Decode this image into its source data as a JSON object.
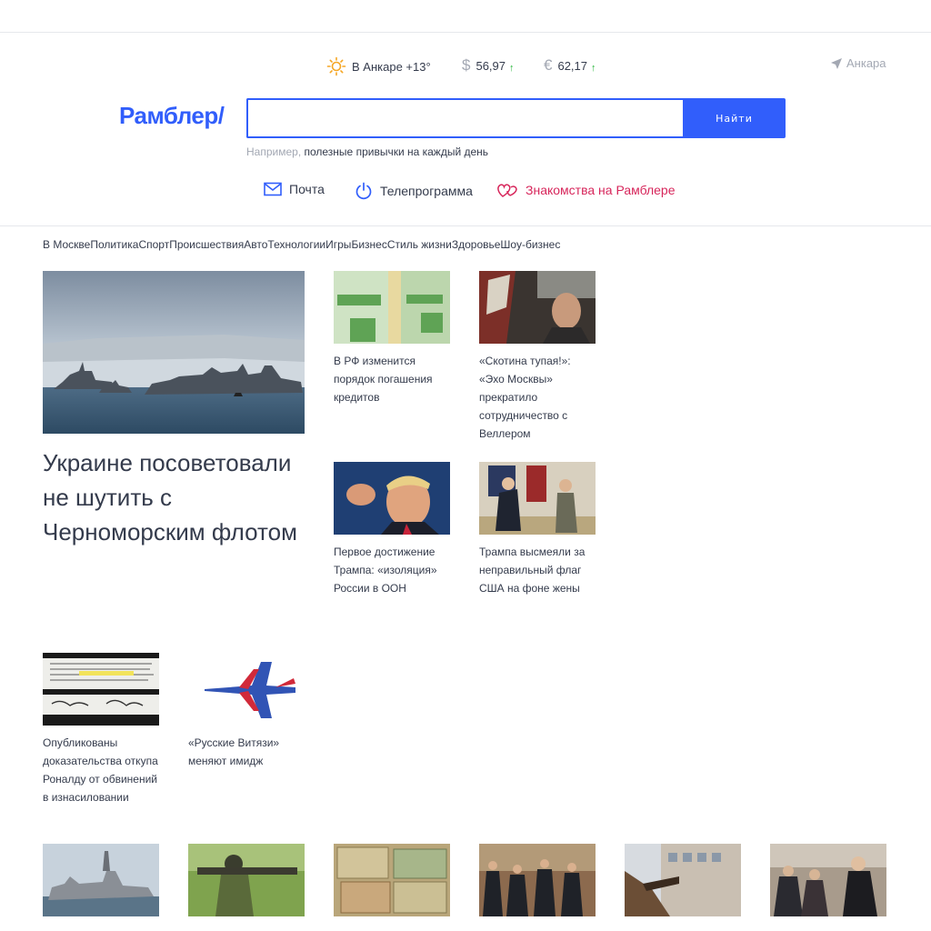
{
  "header": {
    "weather": {
      "icon": "sun-icon",
      "text": "В Анкаре +13°"
    },
    "usd": {
      "symbol": "$",
      "value": "56,97",
      "trend": "up-arrow-icon"
    },
    "eur": {
      "symbol": "€",
      "value": "62,17",
      "trend": "up-arrow-icon"
    },
    "location": "Анкара"
  },
  "search": {
    "logo": "Рамблер/",
    "value": "",
    "button_label": "Найти",
    "hint_prefix": "Например, ",
    "hint_link": "полезные привычки на каждый день"
  },
  "services": [
    {
      "label": "Почта",
      "icon": "mail-icon"
    },
    {
      "label": "Телепрограмма",
      "icon": "power-icon"
    },
    {
      "label": "Знакомства на Рамблере",
      "icon": "hearts-icon"
    }
  ],
  "topics": [
    "В Москве",
    "Политика",
    "Спорт",
    "Происшествия",
    "Авто",
    "Технологии",
    "Игры",
    "Бизнес",
    "Стиль жизни",
    "Здоровье",
    "Шоу-бизнес"
  ],
  "main_news": {
    "title": "Украине посоветовали не шутить с Черноморским флотом"
  },
  "news": [
    {
      "title": "В РФ изменится порядок погашения кредитов"
    },
    {
      "title": "«Скотина тупая!»: «Эхо Москвы» прекратило сотрудничество с Веллером"
    },
    {
      "title": "Первое достижение Трампа: «изоляция» России в ООН"
    },
    {
      "title": "Трампа высмеяли за неправильный флаг США на фоне жены"
    },
    {
      "title": "Опубликованы доказательства откупа Роналду от обвинений в изнасиловании"
    },
    {
      "title": "«Русские Витязи» меняют имидж"
    }
  ],
  "colors": {
    "brand": "#315efb",
    "text": "#343b4c",
    "muted": "#a3a8b3",
    "love": "#d7265b",
    "up": "#27b53a"
  }
}
